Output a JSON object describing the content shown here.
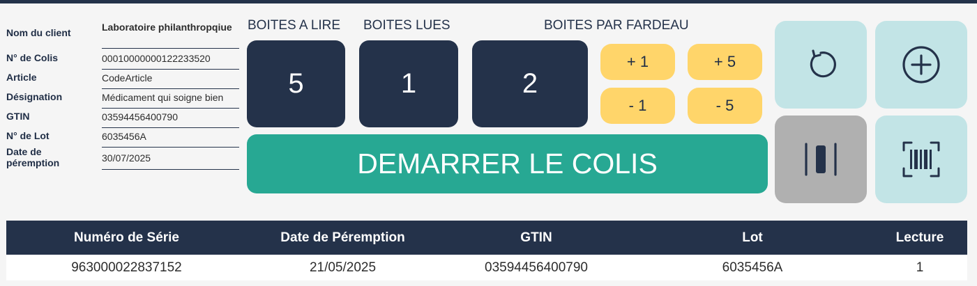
{
  "client_info": {
    "rows": [
      {
        "label": "Nom du client",
        "value": "Laboratoire philanthropqiue"
      },
      {
        "label": "N° de Colis",
        "value": "00010000000122233520"
      },
      {
        "label": "Article",
        "value": "CodeArticle"
      },
      {
        "label": "Désignation",
        "value": "Médicament qui soigne bien"
      },
      {
        "label": "GTIN",
        "value": "03594456400790"
      },
      {
        "label": "N° de Lot",
        "value": "6035456A"
      },
      {
        "label": "Date de péremption",
        "value": "30/07/2025"
      }
    ]
  },
  "counters": {
    "to_read": {
      "label": "BOITES A LIRE",
      "value": "5"
    },
    "read": {
      "label": "BOITES LUES",
      "value": "1"
    },
    "per_bundle": {
      "label": "BOITES PAR FARDEAU",
      "value": "2"
    }
  },
  "adjust": {
    "plus1": "+ 1",
    "plus5": "+ 5",
    "minus1": "- 1",
    "minus5": "- 5"
  },
  "start_button": "DEMARRER LE COLIS",
  "tiles": {
    "reset": "reset-icon",
    "add": "add-circle-icon",
    "pause": "pause-icon",
    "barcode": "barcode-scan-icon"
  },
  "table": {
    "headers": [
      "Numéro de Série",
      "Date de Péremption",
      "GTIN",
      "Lot",
      "Lecture"
    ],
    "rows": [
      [
        "963000022837152",
        "21/05/2025",
        "03594456400790",
        "6035456A",
        "1"
      ]
    ]
  },
  "colors": {
    "navy": "#24324a",
    "teal": "#27a893",
    "yellow": "#ffd56a",
    "light_tile": "#c2e4e6",
    "grey_tile": "#b0b0b0"
  }
}
